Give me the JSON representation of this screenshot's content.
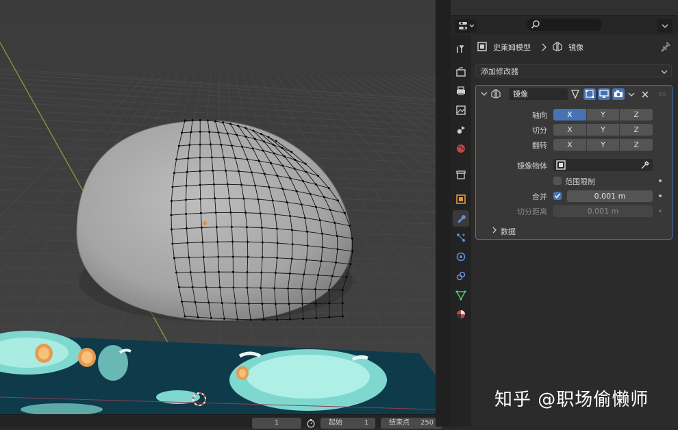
{
  "timeline": {
    "current_frame": "1",
    "start_label": "起始",
    "start_value": "1",
    "end_label": "结束点",
    "end_value": "250"
  },
  "properties": {
    "breadcrumb": {
      "object": "史莱姆模型",
      "modifier": "镜像"
    },
    "add_modifier": "添加修改器",
    "modifier": {
      "name": "镜像",
      "rows": {
        "axis": {
          "label": "轴向",
          "options": [
            "X",
            "Y",
            "Z"
          ],
          "selected": "X"
        },
        "bisect": {
          "label": "切分",
          "options": [
            "X",
            "Y",
            "Z"
          ]
        },
        "flip": {
          "label": "翻转",
          "options": [
            "X",
            "Y",
            "Z"
          ]
        }
      },
      "mirror_object_label": "镜像物体",
      "clipping_label": "范围限制",
      "merge_label": "合并",
      "merge_value": "0.001 m",
      "bisect_distance_label": "切分距离",
      "bisect_distance_value": "0.001 m",
      "data_label": "数据"
    }
  },
  "watermark": "知乎 @职场偷懒师",
  "colors": {
    "accent": "#4772b3",
    "panel": "#383838",
    "field": "#545454"
  }
}
